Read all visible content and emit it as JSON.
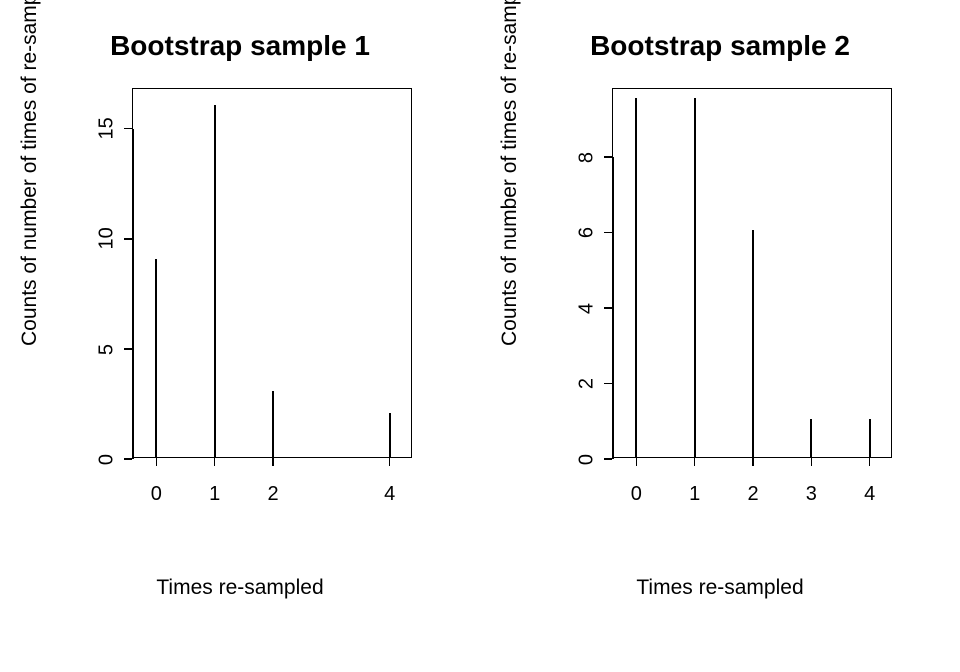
{
  "chart_data": [
    {
      "type": "bar",
      "title": "Bootstrap sample 1",
      "xlabel": "Times re-sampled",
      "ylabel": "Counts of number of times of re-sampling",
      "categories": [
        0,
        1,
        2,
        4
      ],
      "values": [
        9,
        16,
        3,
        2
      ],
      "x_ticks": [
        0,
        1,
        2,
        4
      ],
      "y_ticks": [
        0,
        5,
        10,
        15
      ],
      "xlim": [
        -0.4,
        4.4
      ],
      "ylim": [
        0,
        16.8
      ]
    },
    {
      "type": "bar",
      "title": "Bootstrap sample 2",
      "xlabel": "Times re-sampled",
      "ylabel": "Counts of number of times of re-sampling",
      "categories": [
        0,
        1,
        2,
        3,
        4
      ],
      "values": [
        9.5,
        9.5,
        6,
        1,
        1
      ],
      "x_ticks": [
        0,
        1,
        2,
        3,
        4
      ],
      "y_ticks": [
        0,
        2,
        4,
        6,
        8
      ],
      "xlim": [
        -0.4,
        4.4
      ],
      "ylim": [
        0,
        9.8
      ]
    }
  ]
}
